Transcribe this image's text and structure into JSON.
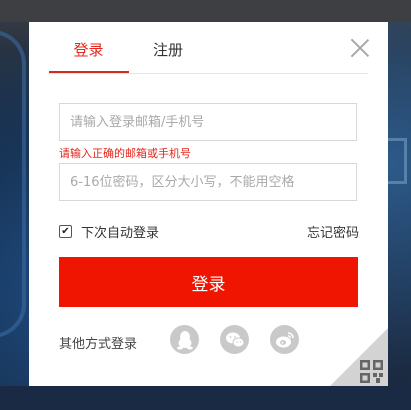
{
  "tabs": {
    "login": "登录",
    "register": "注册"
  },
  "email_field": {
    "placeholder": "请输入登录邮箱/手机号",
    "error": "请输入正确的邮箱或手机号"
  },
  "password_field": {
    "placeholder": "6-16位密码，区分大小写，不能用空格"
  },
  "remember": {
    "label": "下次自动登录",
    "checked": true
  },
  "forgot_label": "忘记密码",
  "login_button": "登录",
  "social": {
    "label": "其他方式登录",
    "providers": [
      {
        "name": "qq-icon"
      },
      {
        "name": "wechat-icon"
      },
      {
        "name": "weibo-icon"
      }
    ]
  },
  "colors": {
    "accent": "#ef1500",
    "tab_active": "#e5281f",
    "error": "#e0261c"
  }
}
